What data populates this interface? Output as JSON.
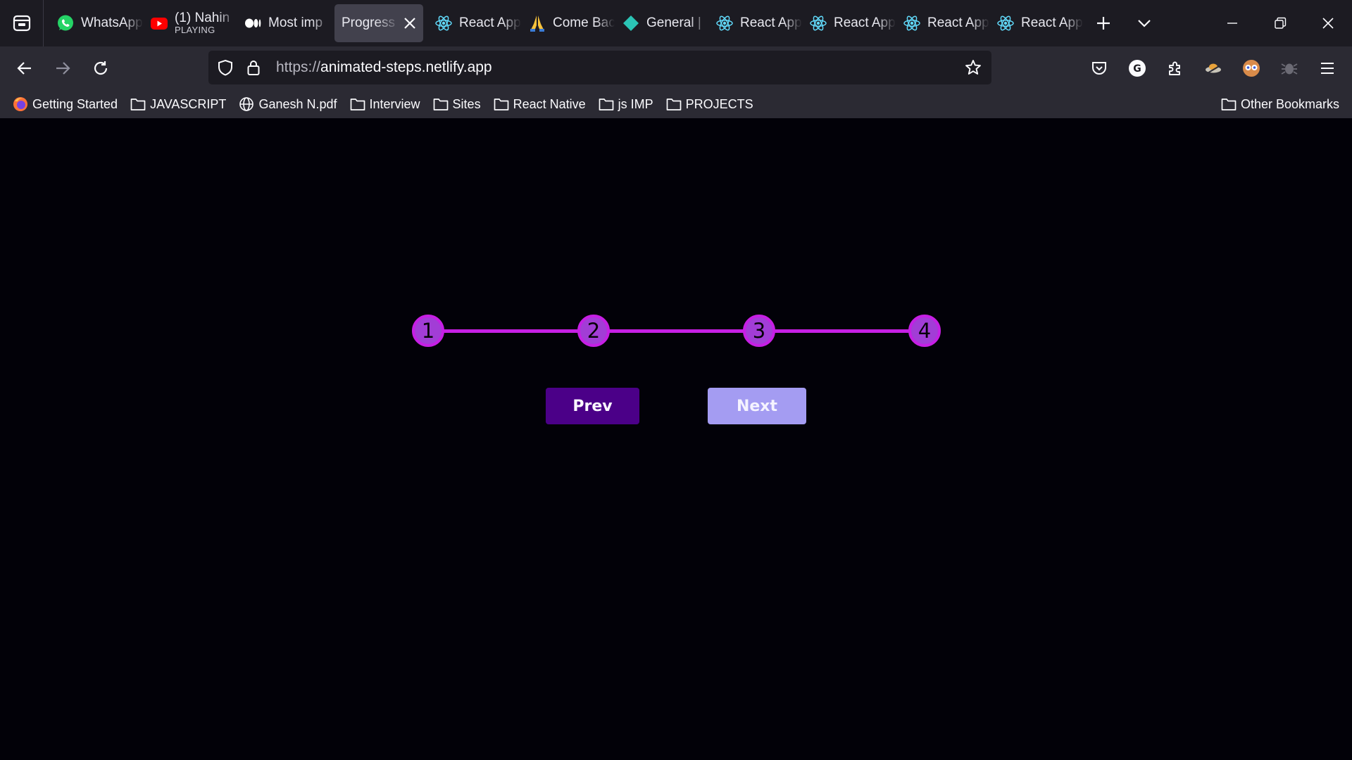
{
  "browser": {
    "tabs": [
      {
        "title": "WhatsApp",
        "icon": "whatsapp-icon",
        "active": false,
        "sub": ""
      },
      {
        "title": "(1) Nahin",
        "icon": "youtube-icon",
        "active": false,
        "sub": "PLAYING"
      },
      {
        "title": "Most imp",
        "icon": "medium-icon",
        "active": false,
        "sub": ""
      },
      {
        "title": "Progress S",
        "icon": "",
        "active": true,
        "sub": ""
      },
      {
        "title": "React App",
        "icon": "react-icon",
        "active": false,
        "sub": ""
      },
      {
        "title": "Come Back",
        "icon": "folded-hands-icon",
        "active": false,
        "sub": ""
      },
      {
        "title": "General |",
        "icon": "diamond-icon",
        "active": false,
        "sub": ""
      },
      {
        "title": "React App",
        "icon": "react-icon",
        "active": false,
        "sub": ""
      },
      {
        "title": "React App",
        "icon": "react-icon",
        "active": false,
        "sub": ""
      },
      {
        "title": "React App",
        "icon": "react-icon",
        "active": false,
        "sub": ""
      },
      {
        "title": "React App",
        "icon": "react-icon",
        "active": false,
        "sub": ""
      }
    ],
    "url_proto": "https://",
    "url_host": "animated-steps.netlify.app",
    "bookmarks": [
      {
        "label": "Getting Started",
        "icon": "firefox-icon"
      },
      {
        "label": "JAVASCRIPT",
        "icon": "folder-icon"
      },
      {
        "label": "Ganesh N.pdf",
        "icon": "globe-icon"
      },
      {
        "label": "Interview",
        "icon": "folder-icon"
      },
      {
        "label": "Sites",
        "icon": "folder-icon"
      },
      {
        "label": "React Native",
        "icon": "folder-icon"
      },
      {
        "label": "js IMP",
        "icon": "folder-icon"
      },
      {
        "label": "PROJECTS",
        "icon": "folder-icon"
      }
    ],
    "other_bookmarks": "Other Bookmarks"
  },
  "app": {
    "steps": [
      "1",
      "2",
      "3",
      "4"
    ],
    "progress": 1.0,
    "prev_label": "Prev",
    "next_label": "Next",
    "colors": {
      "background": "#020108",
      "accent": "#c61fe4",
      "step_fill": "#a23dd6",
      "prev_bg": "#4b0088",
      "next_bg": "#a49cf2"
    }
  }
}
